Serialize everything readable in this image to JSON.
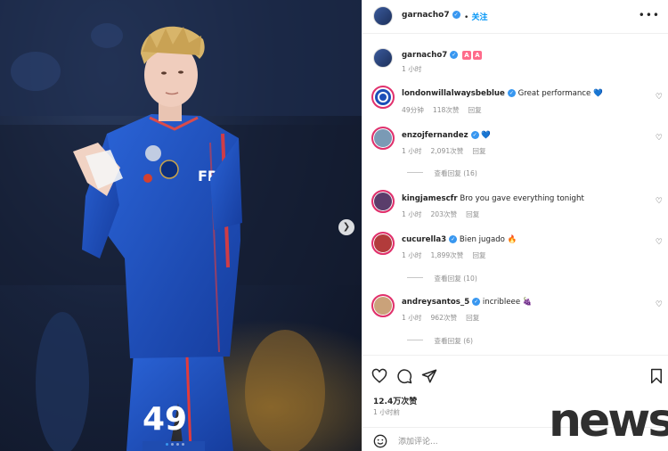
{
  "post": {
    "author": "garnacho7",
    "follow_label": "关注",
    "caption_author": "garnacho7",
    "caption_badges": [
      "A",
      "A"
    ],
    "caption_time": "1 小时"
  },
  "comments": [
    {
      "user": "londonwillalwaysbeblue",
      "text": "Great performance",
      "emoji": "💙",
      "time": "49分钟",
      "likes": "118次赞",
      "reply_label": "回复",
      "view_replies": ""
    },
    {
      "user": "enzojfernandez",
      "text": "",
      "emoji": "💙",
      "time": "1 小时",
      "likes": "2,091次赞",
      "reply_label": "回复",
      "view_replies": "查看回复 (16)"
    },
    {
      "user": "kingjamescfr",
      "text": "Bro you gave everything tonight",
      "emoji": "",
      "time": "1 小时",
      "likes": "203次赞",
      "reply_label": "回复",
      "view_replies": ""
    },
    {
      "user": "cucurella3",
      "text": "Bien jugado",
      "emoji": "🔥",
      "time": "1 小时",
      "likes": "1,899次赞",
      "reply_label": "回复",
      "view_replies": "查看回复 (10)"
    },
    {
      "user": "andreysantos_5",
      "text": "incribleee",
      "emoji": "🍇",
      "time": "1 小时",
      "likes": "962次赞",
      "reply_label": "回复",
      "view_replies": "查看回复 (6)"
    }
  ],
  "actions": {
    "likes_count": "12.4万次赞",
    "posted_time": "1 小时前",
    "comment_placeholder": "添加评论..."
  },
  "photo": {
    "shirt_sponsor": "FPT",
    "shirt_number": "49"
  },
  "watermark": "news",
  "icons": [
    "heart-icon",
    "comment-icon",
    "share-icon",
    "bookmark-icon",
    "emoji-icon",
    "more-icon",
    "verified-icon",
    "chevron-right-icon"
  ],
  "colors": {
    "accent": "#0095f6",
    "verified": "#3897f0",
    "chelsea_blue": "#1d4fb8"
  }
}
